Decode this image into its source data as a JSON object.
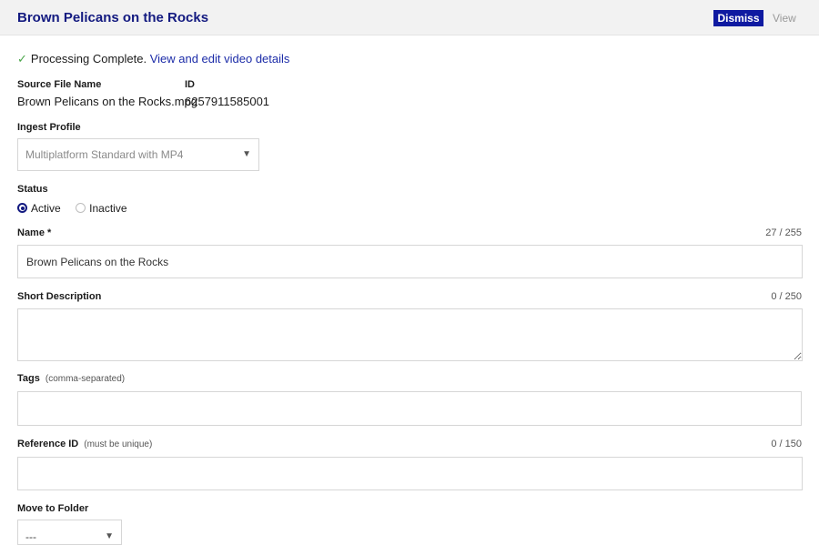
{
  "header": {
    "title": "Brown Pelicans on the Rocks",
    "dismiss_label": "Dismiss",
    "view_label": "View"
  },
  "processing": {
    "text": "Processing Complete.",
    "link": "View and edit video details"
  },
  "source": {
    "file_name_label": "Source File Name",
    "file_name": "Brown Pelicans on the Rocks.mpg",
    "id_label": "ID",
    "id": "6257911585001"
  },
  "ingest": {
    "label": "Ingest Profile",
    "selected": "Multiplatform Standard with MP4"
  },
  "status": {
    "label": "Status",
    "options": [
      "Active",
      "Inactive"
    ],
    "selected": "Active"
  },
  "name": {
    "label": "Name *",
    "counter": "27 / 255",
    "value": "Brown Pelicans on the Rocks"
  },
  "short_description": {
    "label": "Short Description",
    "counter": "0 / 250",
    "value": ""
  },
  "tags": {
    "label": "Tags",
    "hint": "(comma-separated)",
    "value": ""
  },
  "reference_id": {
    "label": "Reference ID",
    "hint": "(must be unique)",
    "counter": "0 / 150",
    "value": ""
  },
  "folder": {
    "label": "Move to Folder",
    "selected": "---"
  },
  "icons": {
    "check": "check-icon",
    "caret": "chevron-down-icon"
  },
  "colors": {
    "brand": "#131a80",
    "button": "#0f1aa1",
    "success": "#4aa64a",
    "header_bg": "#f2f2f2"
  }
}
